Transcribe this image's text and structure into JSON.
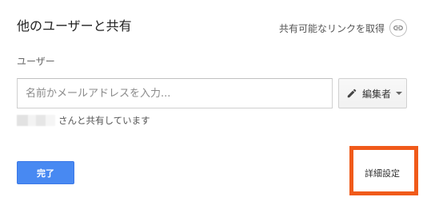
{
  "dialog": {
    "title": "他のユーザーと共有",
    "share_link_label": "共有可能なリンクを取得"
  },
  "users": {
    "label": "ユーザー",
    "input_placeholder": "名前かメールアドレスを入力...",
    "role_label": "編集者"
  },
  "shared_with": {
    "text": "さんと共有しています"
  },
  "actions": {
    "done_label": "完了",
    "advanced_label": "詳細設定"
  },
  "colors": {
    "primary_button": "#4889f2",
    "highlight_border": "#f05a1a"
  },
  "icons": {
    "share_link": "link-icon",
    "role": "pencil-icon",
    "dropdown": "caret-down-icon"
  }
}
